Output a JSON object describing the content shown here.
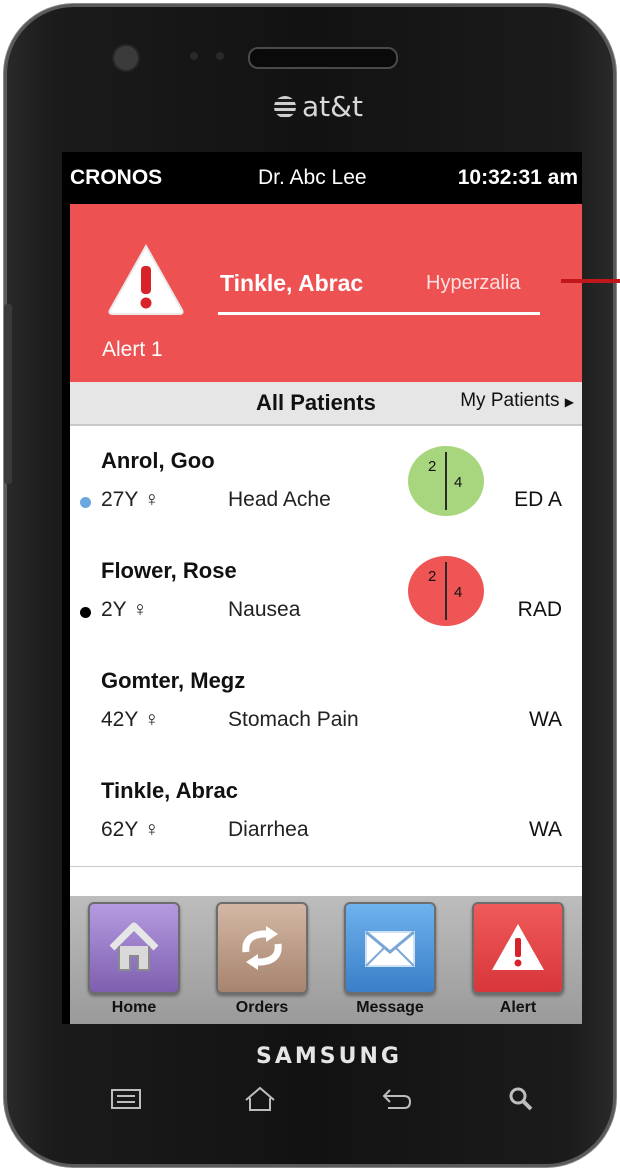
{
  "device": {
    "carrier": "at&t",
    "brand": "SAMSUNG"
  },
  "statusbar": {
    "app_name": "CRONOS",
    "doctor": "Dr. Abc Lee",
    "time": "10:32:31 am"
  },
  "alert": {
    "patient": "Tinkle, Abrac",
    "diagnosis": "Hyperzalia",
    "label": "Alert 1",
    "color": "#ee5151"
  },
  "tabs": {
    "all": "All Patients",
    "mine": "My Patients"
  },
  "patients": [
    {
      "name": "Anrol, Goo",
      "age": "27Y ♀",
      "complaint": "Head Ache",
      "location": "ED A",
      "dot_color": "#6aa6df",
      "score": {
        "a": "2",
        "b": "4",
        "color": "#a8d67e"
      }
    },
    {
      "name": "Flower, Rose",
      "age": "2Y ♀",
      "complaint": "Nausea",
      "location": "RAD",
      "dot_color": "#000000",
      "score": {
        "a": "2",
        "b": "4",
        "color": "#ef5555"
      }
    },
    {
      "name": "Gomter, Megz",
      "age": "42Y ♀",
      "complaint": "Stomach Pain",
      "location": "WA"
    },
    {
      "name": "Tinkle, Abrac",
      "age": "62Y ♀",
      "complaint": "Diarrhea",
      "location": "WA"
    }
  ],
  "nav": [
    {
      "label": "Home",
      "icon": "home-icon",
      "color": "#9b7fc6"
    },
    {
      "label": "Orders",
      "icon": "refresh-icon",
      "color": "#bc9a86"
    },
    {
      "label": "Message",
      "icon": "envelope-icon",
      "color": "#4f93d6"
    },
    {
      "label": "Alert",
      "icon": "warning-icon",
      "color": "#e8464a"
    }
  ]
}
